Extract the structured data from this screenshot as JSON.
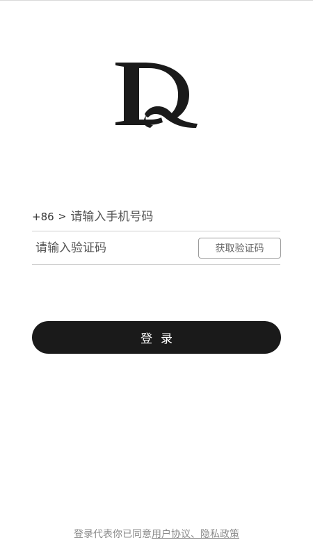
{
  "logo": {
    "name": "dq-logo-icon",
    "color": "#1a1a1a"
  },
  "login_form": {
    "country_code": "+86",
    "country_code_arrow": ">",
    "phone_placeholder": "请输入手机号码",
    "code_placeholder": "请输入验证码",
    "get_code_label": "获取验证码",
    "login_label": "登录"
  },
  "footer": {
    "agreement_prefix": "登录代表你已同意",
    "user_agreement_label": "用户协议",
    "separator": "、",
    "privacy_policy_label": "隐私政策"
  },
  "colors": {
    "primary_button": "#1a1a1a",
    "divider": "#cfcfcf",
    "muted_text": "#8a8a8a"
  }
}
